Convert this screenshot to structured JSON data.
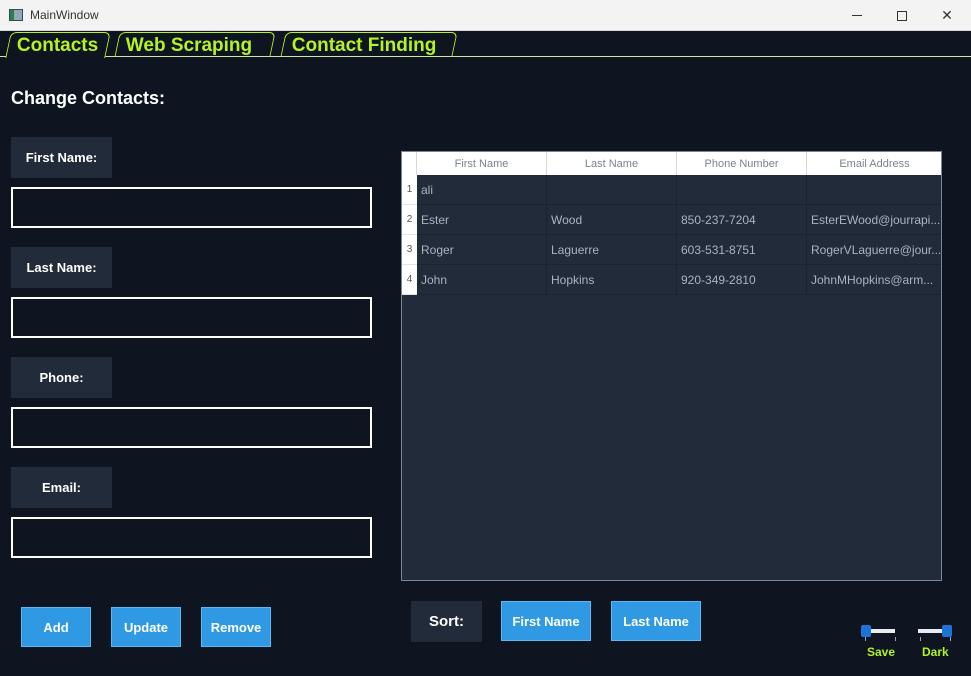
{
  "window": {
    "title": "MainWindow"
  },
  "tabs": [
    {
      "label": "Contacts"
    },
    {
      "label": "Web Scraping"
    },
    {
      "label": "Contact Finding"
    }
  ],
  "form": {
    "heading": "Change Contacts:",
    "first_name_label": "First Name:",
    "last_name_label": "Last Name:",
    "phone_label": "Phone:",
    "email_label": "Email:",
    "first_name_value": "",
    "last_name_value": "",
    "phone_value": "",
    "email_value": ""
  },
  "actions": {
    "add": "Add",
    "update": "Update",
    "remove": "Remove"
  },
  "sort": {
    "label": "Sort:",
    "first_name": "First Name",
    "last_name": "Last Name"
  },
  "table": {
    "columns": [
      "First Name",
      "Last Name",
      "Phone Number",
      "Email Address"
    ],
    "rows": [
      {
        "num": "1",
        "cells": [
          "ali",
          "",
          "",
          ""
        ]
      },
      {
        "num": "2",
        "cells": [
          "Ester",
          "Wood",
          "850-237-7204",
          "EsterEWood@jourrapi..."
        ]
      },
      {
        "num": "3",
        "cells": [
          "Roger",
          "Laguerre",
          "603-531-8751",
          "RogerVLaguerre@jour..."
        ]
      },
      {
        "num": "4",
        "cells": [
          "John",
          "Hopkins",
          "920-349-2810",
          "JohnMHopkins@arm..."
        ]
      }
    ]
  },
  "toggles": {
    "save": {
      "label": "Save",
      "value": 0
    },
    "dark": {
      "label": "Dark",
      "value": 1
    }
  },
  "colors": {
    "accent": "#b5f221",
    "button": "#2f9ae3",
    "background": "#0e1420",
    "panel": "#222b39"
  }
}
